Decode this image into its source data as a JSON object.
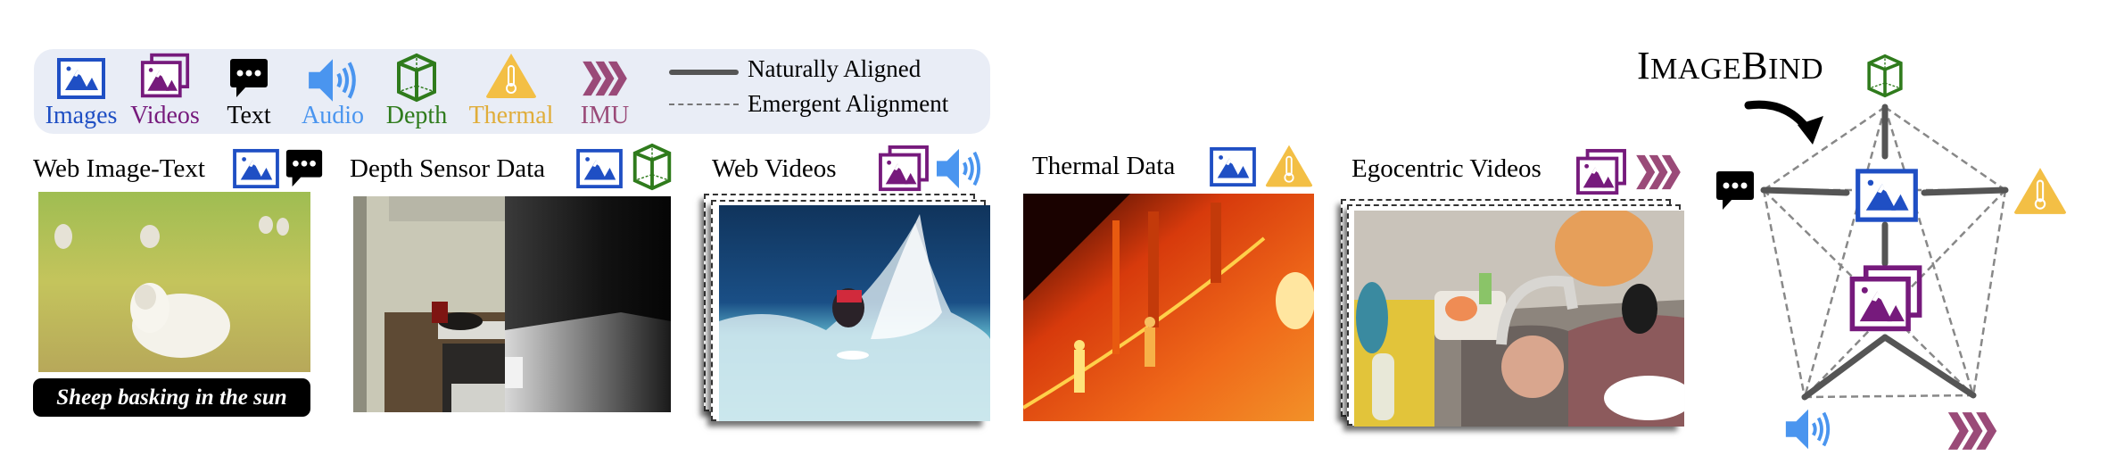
{
  "legend": {
    "modalities": [
      {
        "key": "images",
        "label": "Images",
        "icon": "image-icon",
        "color": "#1f4fc4"
      },
      {
        "key": "videos",
        "label": "Videos",
        "icon": "video-icon",
        "color": "#761a7c"
      },
      {
        "key": "text",
        "label": "Text",
        "icon": "speech-bubble-icon",
        "color": "#000000"
      },
      {
        "key": "audio",
        "label": "Audio",
        "icon": "speaker-icon",
        "color": "#4a95ef"
      },
      {
        "key": "depth",
        "label": "Depth",
        "icon": "cube-icon",
        "color": "#2f7b1c"
      },
      {
        "key": "thermal",
        "label": "Thermal",
        "icon": "thermometer-warning-icon",
        "color": "#e0ad3a"
      },
      {
        "key": "imu",
        "label": "IMU",
        "icon": "chevrons-icon",
        "color": "#9a4a78"
      }
    ],
    "line_types": [
      {
        "style": "solid",
        "label": "Naturally Aligned"
      },
      {
        "style": "dashed",
        "label": "Emergent Alignment"
      }
    ]
  },
  "datasets": [
    {
      "title": "Web Image-Text",
      "modalities": [
        "images",
        "text"
      ],
      "caption": "Sheep basking in the sun",
      "photo": "sheep-in-field-photo"
    },
    {
      "title": "Depth Sensor Data",
      "modalities": [
        "images",
        "depth"
      ],
      "photo": "kitchen-rgb-depth-photo"
    },
    {
      "title": "Web Videos",
      "modalities": [
        "videos",
        "audio"
      ],
      "photo": "surfer-video-frames"
    },
    {
      "title": "Thermal Data",
      "modalities": [
        "images",
        "thermal"
      ],
      "photo": "street-thermal-photo"
    },
    {
      "title": "Egocentric Videos",
      "modalities": [
        "videos",
        "imu"
      ],
      "photo": "sink-egocentric-video-frames"
    }
  ],
  "diagram": {
    "title_first": "I",
    "title_small1": "MAGE",
    "title_mid": "B",
    "title_small2": "IND",
    "center": "images",
    "nodes": [
      "depth",
      "text",
      "thermal",
      "videos",
      "audio",
      "imu"
    ],
    "naturally_aligned": [
      [
        "images",
        "depth"
      ],
      [
        "images",
        "text"
      ],
      [
        "images",
        "thermal"
      ],
      [
        "images",
        "videos"
      ],
      [
        "videos",
        "audio"
      ],
      [
        "videos",
        "imu"
      ]
    ],
    "emergent_alignment": [
      [
        "depth",
        "text"
      ],
      [
        "depth",
        "thermal"
      ],
      [
        "text",
        "audio"
      ],
      [
        "thermal",
        "imu"
      ],
      [
        "audio",
        "imu"
      ],
      [
        "depth",
        "audio"
      ],
      [
        "depth",
        "imu"
      ],
      [
        "text",
        "imu"
      ],
      [
        "thermal",
        "audio"
      ],
      [
        "text",
        "thermal"
      ]
    ]
  }
}
